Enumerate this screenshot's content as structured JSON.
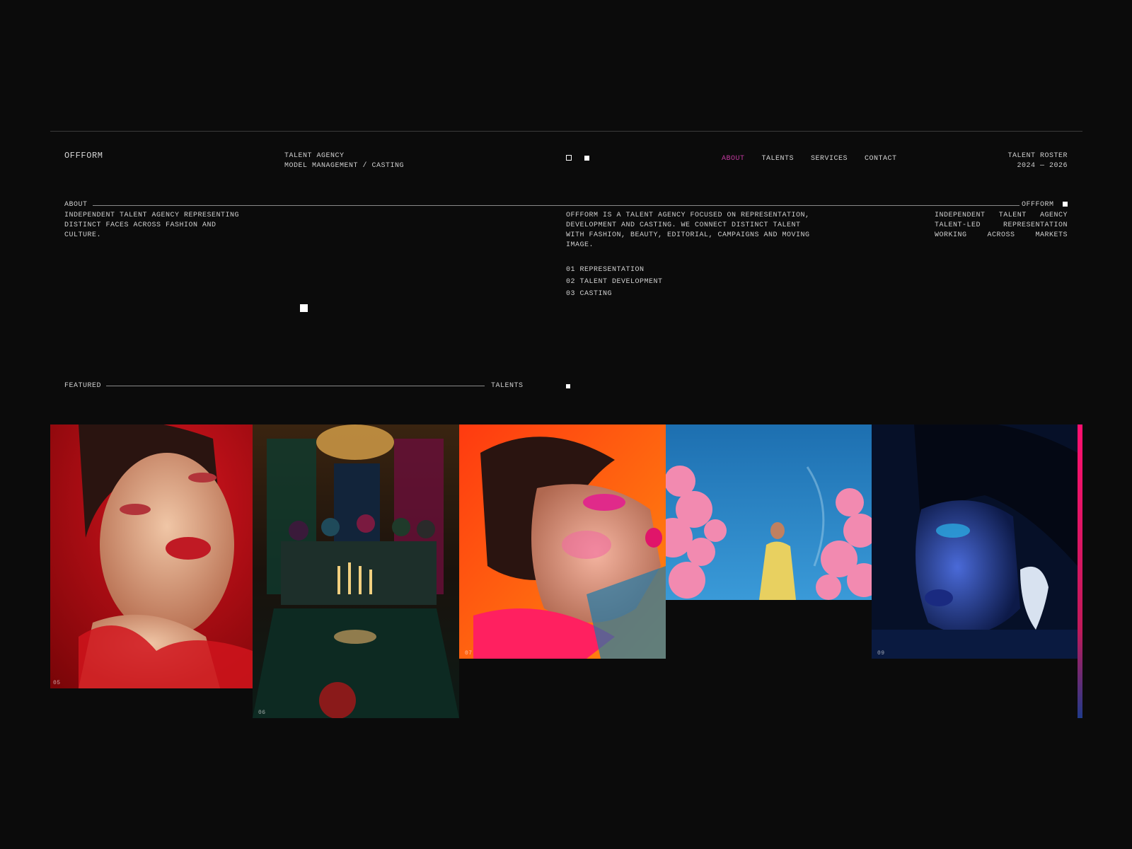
{
  "header": {
    "logo": "OFFFORM",
    "tagline_line1": "TALENT AGENCY",
    "tagline_line2": "MODEL MANAGEMENT / CASTING",
    "nav": [
      {
        "label": "ABOUT",
        "active": true
      },
      {
        "label": "TALENTS",
        "active": false
      },
      {
        "label": "SERVICES",
        "active": false
      },
      {
        "label": "CONTACT",
        "active": false
      }
    ],
    "roster_line1": "TALENT ROSTER",
    "roster_line2": "2024 — 2026"
  },
  "about": {
    "label": "ABOUT",
    "right_label": "OFFFORM",
    "left_text_l1": "INDEPENDENT TALENT AGENCY REPRESENTING",
    "left_text_l2": "DISTINCT FACES ACROSS FASHION AND",
    "left_text_l3": "CULTURE.",
    "main_l1": "OFFFORM IS A TALENT AGENCY FOCUSED ON REPRESENTATION,",
    "main_l2": "DEVELOPMENT AND CASTING. WE CONNECT DISTINCT TALENT",
    "main_l3": "WITH FASHION, BEAUTY, EDITORIAL, CAMPAIGNS AND MOVING",
    "main_l4": "IMAGE.",
    "services": [
      "01 REPRESENTATION",
      "02 TALENT DEVELOPMENT",
      "03 CASTING"
    ],
    "aside_l1": "INDEPENDENT TALENT AGENCY",
    "aside_l2": "TALENT-LED REPRESENTATION",
    "aside_l3": "WORKING ACROSS MARKETS"
  },
  "featured": {
    "label": "FEATURED",
    "right_label": "TALENTS",
    "tiles": [
      {
        "num": "05",
        "subject": "red beauty portrait"
      },
      {
        "num": "06",
        "subject": "group dinner scene"
      },
      {
        "num": "07",
        "subject": "orange pink profile portrait"
      },
      {
        "num": "",
        "subject": "woman among cherry blossoms"
      },
      {
        "num": "09",
        "subject": "blue-lit portrait with earring"
      }
    ]
  },
  "colors": {
    "background": "#0b0b0b",
    "text": "#cfcfcf",
    "accent": "#c33aa0"
  }
}
